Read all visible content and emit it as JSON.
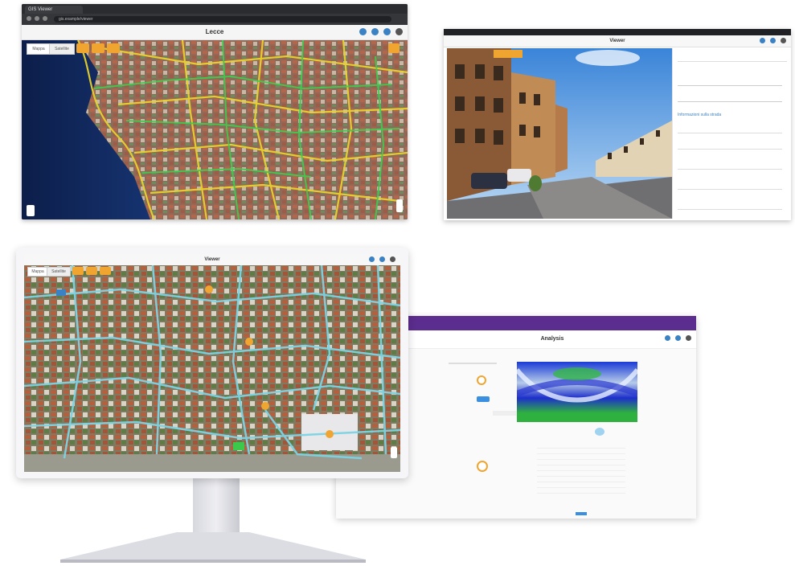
{
  "browser": {
    "tab_label": "GIS Viewer",
    "url": "gis.example/viewer",
    "app_title": "Lecce",
    "map_toggle": [
      "Mappa",
      "Satellite"
    ],
    "tool_labels": [
      "",
      "",
      ""
    ],
    "accent": "#f0a531"
  },
  "streetview": {
    "app_title": "Viewer",
    "section_title": "Informazioni sulla strada",
    "fields": [
      "",
      "",
      "",
      "",
      "",
      ""
    ]
  },
  "monitor": {
    "app_title": "Viewer",
    "map_toggle": [
      "Mappa",
      "Satellite"
    ]
  },
  "gpr": {
    "app_title": "Analysis",
    "header_color": "#5b2d8e",
    "info_rows": [
      "",
      "",
      "",
      "",
      "",
      "",
      "",
      "",
      ""
    ]
  }
}
